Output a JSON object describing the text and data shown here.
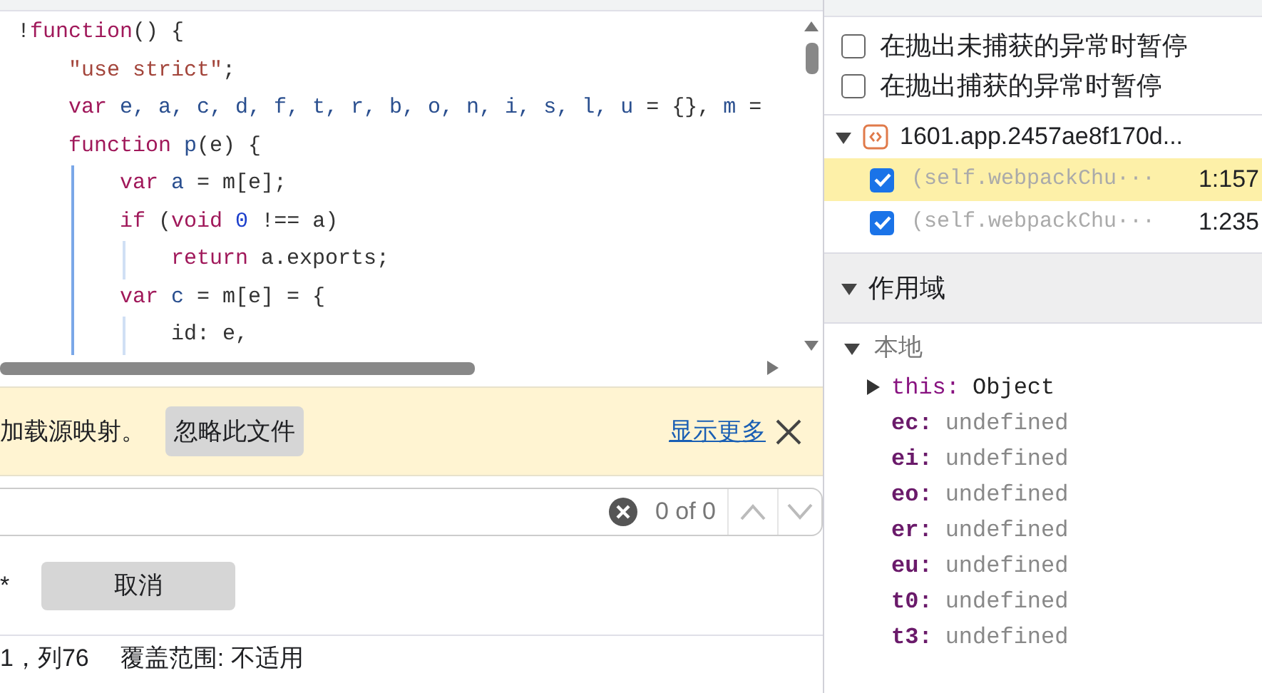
{
  "code_lines": [
    {
      "tokens": [
        {
          "kind": "punct",
          "text": "!"
        },
        {
          "kind": "keyword",
          "text": "function"
        },
        {
          "kind": "punct",
          "text": "() {"
        }
      ],
      "children": [
        {
          "tokens": [
            {
              "kind": "string",
              "text": "\"use strict\""
            },
            {
              "kind": "punct",
              "text": ";"
            }
          ]
        },
        {
          "tokens": [
            {
              "kind": "keyword",
              "text": "var"
            },
            {
              "kind": "variable",
              "text": " e, a, c, d, f, t, r, b, o, n, i, s, l, u"
            },
            {
              "kind": "punct",
              "text": " = {}, "
            },
            {
              "kind": "variable",
              "text": "m"
            },
            {
              "kind": "punct",
              "text": " ="
            }
          ]
        },
        {
          "tokens": [
            {
              "kind": "keyword",
              "text": "function"
            },
            {
              "kind": "variable",
              "text": " p"
            },
            {
              "kind": "punct",
              "text": "(e) {"
            }
          ],
          "children": [
            {
              "tokens": [
                {
                  "kind": "keyword",
                  "text": "var"
                },
                {
                  "kind": "variable",
                  "text": " a"
                },
                {
                  "kind": "punct",
                  "text": " = m[e];"
                }
              ]
            },
            {
              "tokens": [
                {
                  "kind": "keyword",
                  "text": "if"
                },
                {
                  "kind": "punct",
                  "text": " ("
                },
                {
                  "kind": "keyword",
                  "text": "void"
                },
                {
                  "kind": "number",
                  "text": " 0"
                },
                {
                  "kind": "punct",
                  "text": " !== a)"
                }
              ],
              "children": [
                {
                  "tokens": [
                    {
                      "kind": "keyword",
                      "text": "return"
                    },
                    {
                      "kind": "punct",
                      "text": " a.exports;"
                    }
                  ]
                }
              ]
            },
            {
              "tokens": [
                {
                  "kind": "keyword",
                  "text": "var"
                },
                {
                  "kind": "variable",
                  "text": " c"
                },
                {
                  "kind": "punct",
                  "text": " = m[e] = {"
                }
              ],
              "children": [
                {
                  "tokens": [
                    {
                      "kind": "punct",
                      "text": "id: e,"
                    }
                  ]
                }
              ]
            }
          ]
        }
      ]
    }
  ],
  "infobar": {
    "message": "加载源映射。",
    "ignore_button": "忽略此文件",
    "link": "显示更多"
  },
  "search": {
    "count": "0 of 0"
  },
  "cancel_button": "取消",
  "search_mode_mark": "*",
  "status_bar": {
    "position": "1，列76",
    "coverage": "覆盖范围: 不适用"
  },
  "pause_options": [
    {
      "label": "在抛出未捕获的异常时暂停",
      "checked": false
    },
    {
      "label": "在抛出捕获的异常时暂停",
      "checked": false
    }
  ],
  "breakpoint_file": {
    "name": "1601.app.2457ae8f170d...",
    "expanded": true
  },
  "breakpoints": [
    {
      "code": "(self.webpackChu···",
      "location": "1:157",
      "checked": true,
      "selected": true
    },
    {
      "code": "(self.webpackChu···",
      "location": "1:235",
      "checked": true,
      "selected": false
    }
  ],
  "scope": {
    "title": "作用域",
    "expanded": true,
    "local": {
      "title": "本地",
      "expanded": true,
      "items": [
        {
          "name": "this:",
          "value": "Object",
          "kind": "object"
        },
        {
          "name": "ec:",
          "value": "undefined",
          "kind": "plain"
        },
        {
          "name": "ei:",
          "value": "undefined",
          "kind": "plain"
        },
        {
          "name": "eo:",
          "value": "undefined",
          "kind": "plain"
        },
        {
          "name": "er:",
          "value": "undefined",
          "kind": "plain"
        },
        {
          "name": "eu:",
          "value": "undefined",
          "kind": "plain"
        },
        {
          "name": "t0:",
          "value": "undefined",
          "kind": "plain"
        },
        {
          "name": "t3:",
          "value": "undefined",
          "kind": "plain"
        }
      ]
    }
  }
}
